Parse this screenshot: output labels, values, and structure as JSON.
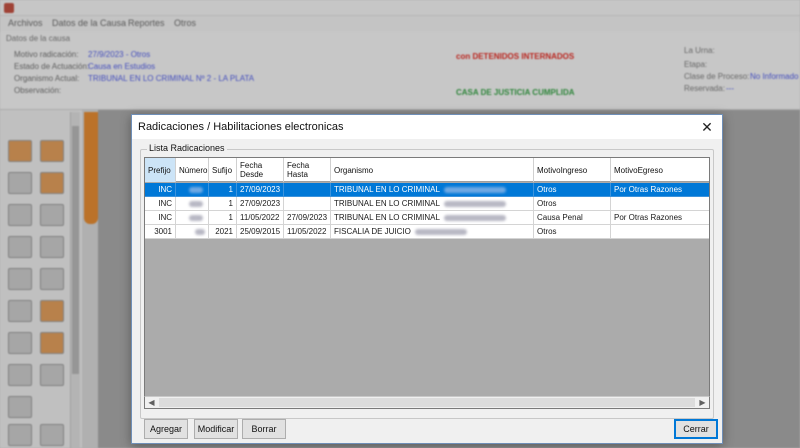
{
  "background": {
    "menu": [
      "Archivos",
      "Datos de la Causa",
      "Reportes",
      "Otros"
    ],
    "section_label": "Datos de la causa",
    "fields": [
      {
        "label": "Motivo radicación:",
        "value": "27/9/2023 - Otros"
      },
      {
        "label": "Estado de Actuación:",
        "value": "Causa en Estudios"
      },
      {
        "label": "Organismo Actual:",
        "value": "TRIBUNAL EN LO CRIMINAL Nº 2 - LA PLATA"
      },
      {
        "label": "Observación:",
        "value": ""
      }
    ],
    "alerts": {
      "detained": "con DETENIDOS INTERNADOS",
      "justice": "CASA DE JUSTICIA CUMPLIDA"
    },
    "right_fields": [
      {
        "label": "La Urna:",
        "value": ""
      },
      {
        "label": "Etapa:",
        "value": ""
      },
      {
        "label": "Clase de Proceso:",
        "value": "No Informado"
      },
      {
        "label": "Reservada:",
        "value": "---"
      }
    ],
    "colors": {
      "accent": "#4a57e6",
      "alert_red": "#e2231a",
      "alert_green": "#2e9e3e",
      "tab_orange": "#e4872a"
    }
  },
  "dialog": {
    "title": "Radicaciones / Habilitaciones electronicas",
    "close_icon": "close-icon",
    "group_label": "Lista Radicaciones",
    "columns": [
      "Prefijo",
      "Número",
      "Sufijo",
      "Fecha Desde",
      "Fecha Hasta",
      "Organismo",
      "MotivoIngreso",
      "MotivoEgreso"
    ],
    "rows": [
      {
        "prefijo": "INC",
        "sufijo": "1",
        "desde": "27/09/2023",
        "hasta": "",
        "organismo": "TRIBUNAL EN LO CRIMINAL",
        "ingreso": "Otros",
        "egreso": "Por Otras Razones"
      },
      {
        "prefijo": "INC",
        "sufijo": "1",
        "desde": "27/09/2023",
        "hasta": "",
        "organismo": "TRIBUNAL EN LO CRIMINAL",
        "ingreso": "Otros",
        "egreso": ""
      },
      {
        "prefijo": "INC",
        "sufijo": "1",
        "desde": "11/05/2022",
        "hasta": "27/09/2023",
        "organismo": "TRIBUNAL EN LO CRIMINAL",
        "ingreso": "Causa Penal",
        "egreso": "Por Otras Razones"
      },
      {
        "prefijo": "3001",
        "sufijo": "2021",
        "desde": "25/09/2015",
        "hasta": "11/05/2022",
        "organismo": "FISCALIA DE JUICIO",
        "ingreso": "Otros",
        "egreso": ""
      }
    ],
    "buttons": {
      "add": "Agregar",
      "modify": "Modificar",
      "delete": "Borrar",
      "close": "Cerrar"
    },
    "colors": {
      "selection": "#0078d7",
      "header_selected": "#cce4f7"
    }
  }
}
